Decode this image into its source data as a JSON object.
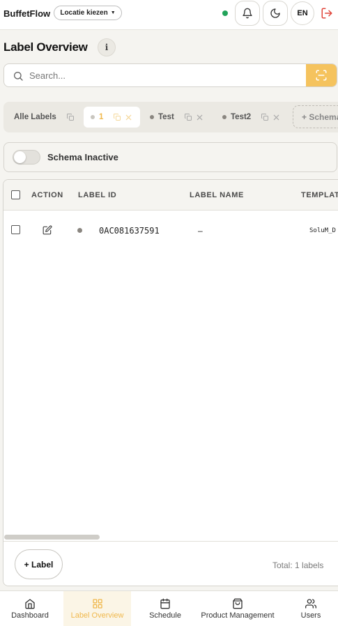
{
  "header": {
    "brand": "BuffetFlow",
    "location_select": "Locatie kiezen",
    "status_color": "#22a35a",
    "language": "EN",
    "icons": [
      "bell-icon",
      "moon-icon",
      "logout-icon"
    ]
  },
  "page": {
    "title": "Label Overview",
    "info_icon": "i"
  },
  "search": {
    "placeholder": "Search...",
    "scan_button_icon": "scan-icon"
  },
  "schemas": {
    "tabs": [
      {
        "label": "Alle Labels",
        "active": false,
        "has_dot": false,
        "removable": false
      },
      {
        "label": "1",
        "active": true,
        "has_dot": true,
        "removable": true
      },
      {
        "label": "Test",
        "active": false,
        "has_dot": true,
        "removable": true
      },
      {
        "label": "Test2",
        "active": false,
        "has_dot": true,
        "removable": true
      }
    ],
    "add_label": "+ Schema"
  },
  "schema_toggle": {
    "label": "Schema Inactive",
    "on": false
  },
  "table": {
    "columns": [
      "ACTION",
      "LABEL ID",
      "LABEL NAME",
      "TEMPLATE"
    ],
    "rows": [
      {
        "label_id": "0AC081637591",
        "label_name": "–",
        "template": "SoluM_D"
      }
    ]
  },
  "footer": {
    "add_button": "+ Label",
    "total": "Total: 1 labels"
  },
  "bottom_nav": [
    {
      "label": "Dashboard",
      "icon": "home-icon",
      "active": false
    },
    {
      "label": "Label Overview",
      "icon": "grid-icon",
      "active": true
    },
    {
      "label": "Schedule",
      "icon": "calendar-icon",
      "active": false
    },
    {
      "label": "Product Management",
      "icon": "bag-icon",
      "active": false
    },
    {
      "label": "Users",
      "icon": "users-icon",
      "active": false
    }
  ],
  "colors": {
    "accent": "#f5c35e",
    "accent_text": "#f0b84c",
    "background": "#f5f4f0"
  }
}
